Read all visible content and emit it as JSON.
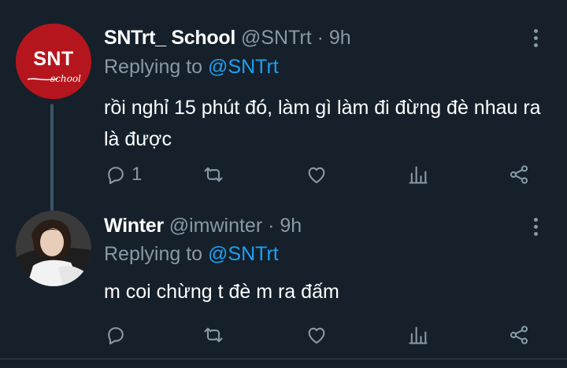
{
  "tweets": [
    {
      "avatar": {
        "line1": "SNT",
        "line2": "school"
      },
      "display_name": "SNTrt_ School",
      "handle": "@SNTrt",
      "separator": "·",
      "time": "9h",
      "replying_label": "Replying to",
      "replying_handle": "@SNTrt",
      "text": "rồi nghỉ 15 phút đó, làm gì làm đi đừng đè nhau ra là được",
      "reply_count": "1"
    },
    {
      "display_name": "Winter",
      "handle": "@imwinter",
      "separator": "·",
      "time": "9h",
      "replying_label": "Replying to",
      "replying_handle": "@SNTrt",
      "text": "m coi chừng t đè m ra đấm",
      "reply_count": ""
    }
  ],
  "colors": {
    "background": "#15202b",
    "muted": "#8899a6",
    "link": "#1da1f2",
    "avatar_red": "#b5161d",
    "thread_line": "#3d5466"
  },
  "icons": [
    "more-vertical-icon",
    "reply-icon",
    "retweet-icon",
    "like-icon",
    "analytics-icon",
    "share-icon"
  ]
}
